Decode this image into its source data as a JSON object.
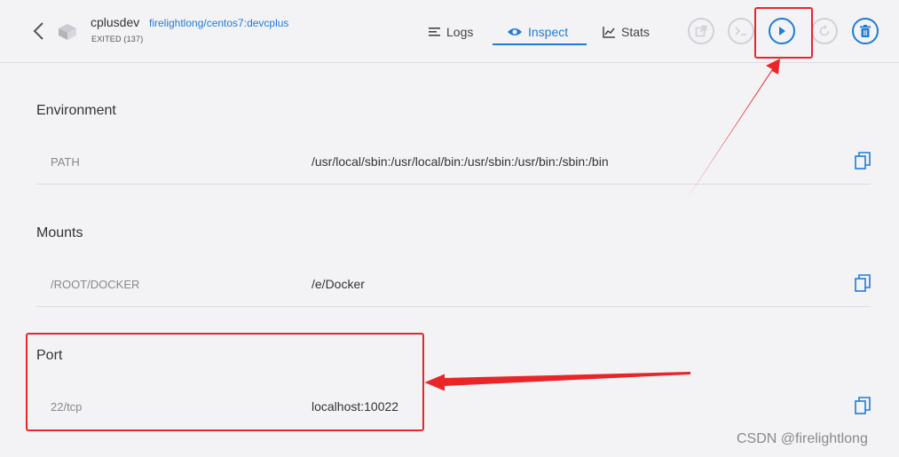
{
  "header": {
    "container_name": "cplusdev",
    "image": "firelightlong/centos7:devcplus",
    "status": "EXITED (137)"
  },
  "tabs": [
    {
      "label": "Logs",
      "icon": "lines-icon"
    },
    {
      "label": "Inspect",
      "icon": "eye-icon",
      "active": true
    },
    {
      "label": "Stats",
      "icon": "chart-line-icon"
    }
  ],
  "actions": [
    "open-browser",
    "exec-terminal",
    "start",
    "restart",
    "delete"
  ],
  "sections": {
    "environment": {
      "title": "Environment",
      "key": "PATH",
      "value": "/usr/local/sbin:/usr/local/bin:/usr/sbin:/usr/bin:/sbin:/bin"
    },
    "mounts": {
      "title": "Mounts",
      "key": "/ROOT/DOCKER",
      "value": "/e/Docker"
    },
    "port": {
      "title": "Port",
      "key": "22/tcp",
      "value": "localhost:10022"
    }
  },
  "colors": {
    "accent": "#1f7bd8",
    "annotation": "#e8262a",
    "background": "#f3f3f6"
  },
  "watermark": "CSDN @firelightlong"
}
